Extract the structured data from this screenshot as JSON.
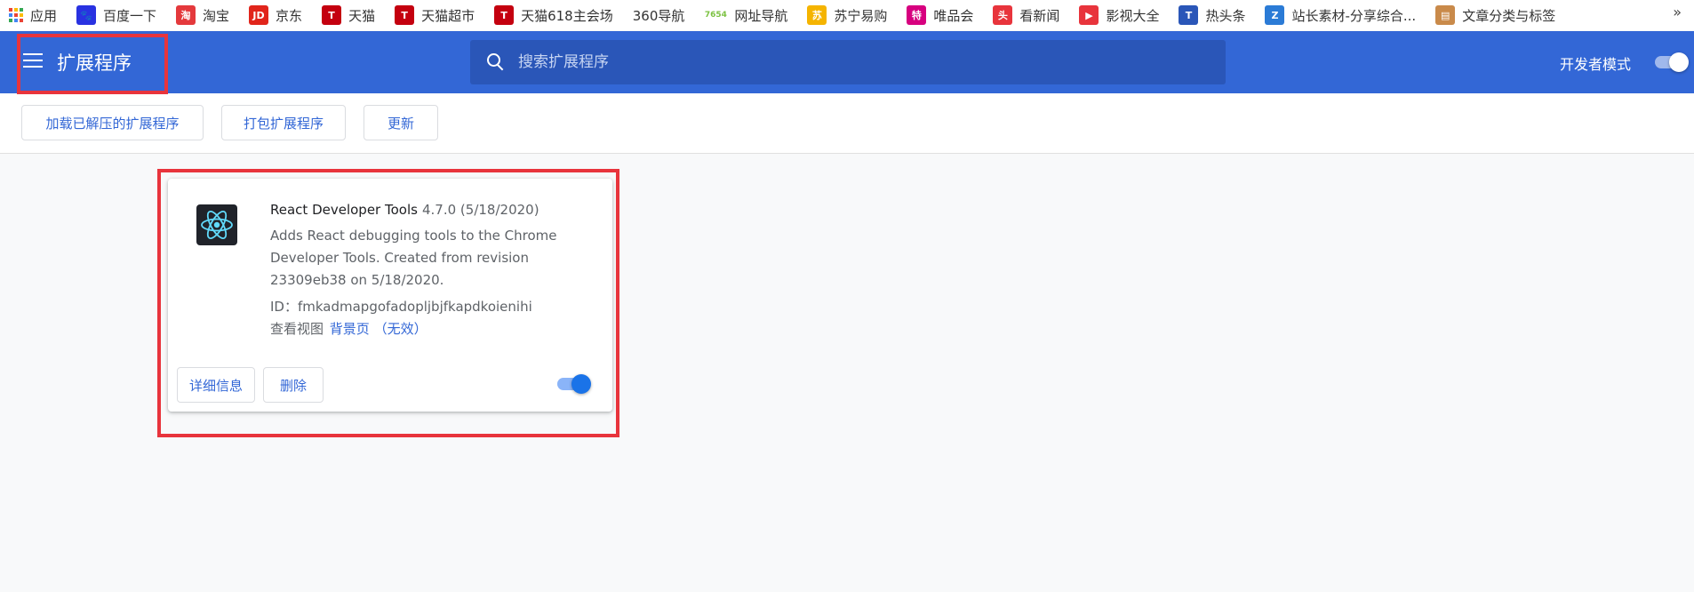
{
  "bookmarks": [
    {
      "label": "应用",
      "icon": "apps-grid-icon"
    },
    {
      "label": "百度一下",
      "icon": "baidu-paw-icon",
      "color": "#2932e1",
      "glyph": "🐾"
    },
    {
      "label": "淘宝",
      "icon": "taobao-icon",
      "color": "#e4393c",
      "glyph": "淘"
    },
    {
      "label": "京东",
      "icon": "jd-icon",
      "color": "#e1251b",
      "glyph": "JD"
    },
    {
      "label": "天猫",
      "icon": "tmall-icon",
      "color": "#c4000f",
      "glyph": "T"
    },
    {
      "label": "天猫超市",
      "icon": "tmall-icon",
      "color": "#c4000f",
      "glyph": "T"
    },
    {
      "label": "天猫618主会场",
      "icon": "tmall-icon",
      "color": "#c4000f",
      "glyph": "T"
    },
    {
      "label": "360导航",
      "icon": "blank-icon",
      "color": "",
      "glyph": ""
    },
    {
      "label": "网址导航",
      "icon": "7654-icon",
      "color": "#7cc242",
      "glyph": "7654"
    },
    {
      "label": "苏宁易购",
      "icon": "suning-icon",
      "color": "#f5b400",
      "glyph": "苏"
    },
    {
      "label": "唯品会",
      "icon": "vip-icon",
      "color": "#d7007f",
      "glyph": "特"
    },
    {
      "label": "看新闻",
      "icon": "toutiao-news-icon",
      "color": "#e8343c",
      "glyph": "头"
    },
    {
      "label": "影视大全",
      "icon": "video-play-icon",
      "color": "#e8343c",
      "glyph": "▶"
    },
    {
      "label": "热头条",
      "icon": "rettiao-icon",
      "color": "#2a56b8",
      "glyph": "T"
    },
    {
      "label": "站长素材-分享综合...",
      "icon": "chinaz-icon",
      "color": "#2b7bd6",
      "glyph": "Z"
    },
    {
      "label": "文章分类与标签",
      "icon": "folder-icon",
      "color": "#c98a4a",
      "glyph": "▤"
    }
  ],
  "bookmarks_more": "»",
  "header": {
    "title": "扩展程序",
    "search_placeholder": "搜索扩展程序",
    "dev_mode_label": "开发者模式",
    "dev_mode_on": true,
    "accent": "#3367d6"
  },
  "toolbar": {
    "load_unpacked": "加载已解压的扩展程序",
    "pack": "打包扩展程序",
    "update": "更新"
  },
  "extension": {
    "name": "React Developer Tools",
    "version": "4.7.0 (5/18/2020)",
    "description": "Adds React debugging tools to the Chrome Developer Tools. Created from revision 23309eb38 on 5/18/2020.",
    "id_line": "ID：fmkadmapgofadopljbjfkapdkoienihi",
    "views_label": "查看视图",
    "views_link": "背景页 （无效）",
    "details_button": "详细信息",
    "remove_button": "删除",
    "enabled": true
  }
}
